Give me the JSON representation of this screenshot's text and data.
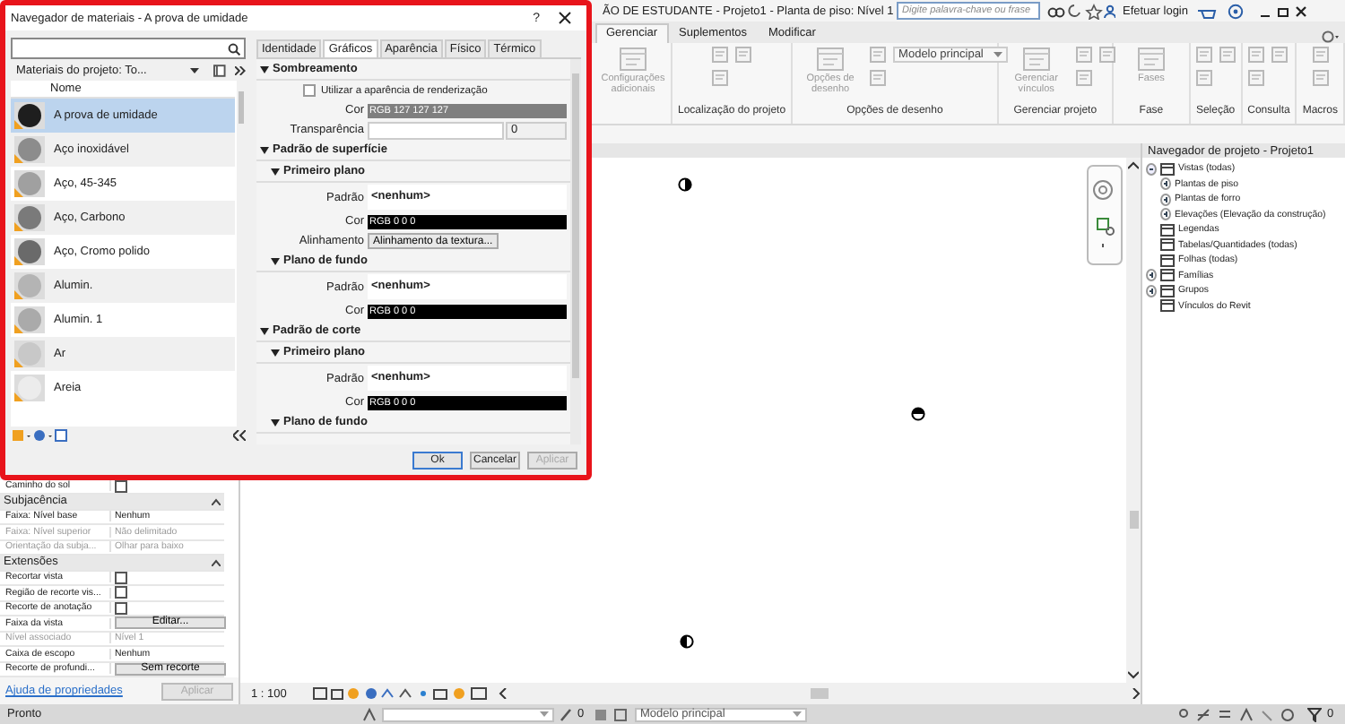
{
  "title_bar": {
    "title": "ÃO DE ESTUDANTE - Projeto1 - Planta de piso: Nível 1",
    "search": {
      "placeholder": "Digite palavra-chave ou frase"
    },
    "login": "Efetuar login"
  },
  "ribbon": {
    "tabs": [
      {
        "label": "Gerenciar",
        "selected": true
      },
      {
        "label": "Suplementos",
        "selected": false
      },
      {
        "label": "Modificar",
        "selected": false
      }
    ],
    "groups": [
      {
        "disabled": true,
        "tools": [
          {
            "kind": "large",
            "label": "Configurações adicionais"
          }
        ]
      },
      {
        "label": "Localização do projeto",
        "disabled": true,
        "tools": [
          {
            "kind": "small"
          },
          {
            "kind": "small"
          },
          {
            "kind": "small"
          }
        ]
      },
      {
        "label": "Opções de desenho",
        "disabled": true,
        "tools": [
          {
            "kind": "large",
            "label": "Opções de desenho"
          },
          {
            "kind": "small"
          },
          {
            "kind": "small"
          },
          {
            "kind": "dropdown",
            "label": "Modelo principal"
          }
        ]
      },
      {
        "label": "Gerenciar projeto",
        "disabled": true,
        "tools": [
          {
            "kind": "large",
            "label": "Gerenciar vínculos"
          },
          {
            "kind": "small"
          },
          {
            "kind": "small"
          },
          {
            "kind": "small"
          }
        ]
      },
      {
        "label": "Fase",
        "disabled": true,
        "tools": [
          {
            "kind": "large",
            "label": "Fases"
          }
        ]
      },
      {
        "label": "Seleção",
        "disabled": true,
        "tools": [
          {
            "kind": "small"
          },
          {
            "kind": "small"
          },
          {
            "kind": "small"
          }
        ]
      },
      {
        "label": "Consulta",
        "disabled": true,
        "tools": [
          {
            "kind": "small"
          },
          {
            "kind": "small"
          },
          {
            "kind": "small"
          }
        ]
      },
      {
        "label": "Macros",
        "disabled": true,
        "tools": [
          {
            "kind": "small"
          },
          {
            "kind": "small"
          }
        ]
      }
    ]
  },
  "properties": {
    "rows": [
      {
        "kind": "checkbox",
        "label": "Caminho do sol",
        "checked": false
      },
      {
        "kind": "section",
        "label": "Subjacência"
      },
      {
        "kind": "value",
        "label": "Faixa: Nível base",
        "value": "Nenhum",
        "disabled": false
      },
      {
        "kind": "value",
        "label": "Faixa: Nível superior",
        "value": "Não delimitado",
        "disabled": true
      },
      {
        "kind": "value",
        "label": "Orientação da subja...",
        "value": "Olhar para baixo",
        "disabled": true
      },
      {
        "kind": "section",
        "label": "Extensões"
      },
      {
        "kind": "checkbox",
        "label": "Recortar vista",
        "checked": false
      },
      {
        "kind": "checkbox",
        "label": "Região de recorte vis...",
        "checked": false
      },
      {
        "kind": "checkbox",
        "label": "Recorte de anotação",
        "checked": false
      },
      {
        "kind": "button",
        "label": "Faixa da vista",
        "value": "Editar..."
      },
      {
        "kind": "value",
        "label": "Nível associado",
        "value": "Nível 1",
        "disabled": true
      },
      {
        "kind": "value",
        "label": "Caixa de escopo",
        "value": "Nenhum",
        "disabled": false
      },
      {
        "kind": "button",
        "label": "Recorte de profundi...",
        "value": "Sem recorte"
      }
    ],
    "help_link": "Ajuda de propriedades",
    "apply": {
      "label": "Aplicar",
      "disabled": true
    }
  },
  "view": {
    "scale": "1 : 100"
  },
  "project_browser": {
    "title": "Navegador de projeto - Projeto1",
    "tree": [
      {
        "label": "Vistas (todas)",
        "expanded": true,
        "children": [
          {
            "label": "Plantas de piso",
            "expanded": false
          },
          {
            "label": "Plantas de forro",
            "expanded": false
          },
          {
            "label": "Elevações (Elevação da construção)",
            "expanded": false
          }
        ]
      },
      {
        "label": "Legendas"
      },
      {
        "label": "Tabelas/Quantidades (todas)"
      },
      {
        "label": "Folhas (todas)"
      },
      {
        "label": "Famílias",
        "expanded": false
      },
      {
        "label": "Grupos",
        "expanded": false
      },
      {
        "label": "Vínculos do Revit"
      }
    ]
  },
  "status_bar": {
    "status": "Pronto",
    "editable_count": "0",
    "model": "Modelo principal",
    "filter_count": "0"
  },
  "material_browser": {
    "title": "Navegador de materiais - A prova de umidade",
    "help": "?",
    "library_filter": "Materiais do projeto: To...",
    "column": "Nome",
    "materials": [
      {
        "name": "A prova de umidade",
        "selected": true,
        "color": "#1e1e1e"
      },
      {
        "name": "Aço inoxidável",
        "selected": false,
        "color": "#8c8c8c"
      },
      {
        "name": "Aço, 45-345",
        "selected": false,
        "color": "#a0a0a0"
      },
      {
        "name": "Aço, Carbono",
        "selected": false,
        "color": "#7a7a7a"
      },
      {
        "name": "Aço, Cromo polido",
        "selected": false,
        "color": "#6a6a6a"
      },
      {
        "name": "Alumin.",
        "selected": false,
        "color": "#b4b4b4"
      },
      {
        "name": "Alumin. 1",
        "selected": false,
        "color": "#aaaaaa"
      },
      {
        "name": "Ar",
        "selected": false,
        "color": "#c8c8c8"
      },
      {
        "name": "Areia",
        "selected": false,
        "color": "#ececec"
      }
    ],
    "tabs": [
      {
        "label": "Identidade",
        "selected": false
      },
      {
        "label": "Gráficos",
        "selected": true
      },
      {
        "label": "Aparência",
        "selected": false
      },
      {
        "label": "Físico",
        "selected": false
      },
      {
        "label": "Térmico",
        "selected": false
      }
    ],
    "sections": [
      {
        "label": "Sombreamento",
        "rows": [
          {
            "kind": "checkbox",
            "label": "Utilizar a aparência de renderização",
            "checked": false
          },
          {
            "kind": "color",
            "label": "Cor",
            "value": "RGB 127 127 127",
            "color": "#7f7f7f"
          },
          {
            "kind": "transparency",
            "label": "Transparência",
            "value": "0"
          }
        ]
      },
      {
        "label": "Padrão de superfície",
        "subsections": [
          {
            "label": "Primeiro plano",
            "rows": [
              {
                "kind": "pattern",
                "label": "Padrão",
                "value": "<nenhum>"
              },
              {
                "kind": "color",
                "label": "Cor",
                "value": "RGB 0 0 0",
                "color": "#000000"
              },
              {
                "kind": "button",
                "label": "Alinhamento",
                "value": "Alinhamento da textura..."
              }
            ]
          },
          {
            "label": "Plano de fundo",
            "rows": [
              {
                "kind": "pattern",
                "label": "Padrão",
                "value": "<nenhum>"
              },
              {
                "kind": "color",
                "label": "Cor",
                "value": "RGB 0 0 0",
                "color": "#000000"
              }
            ]
          }
        ]
      },
      {
        "label": "Padrão de corte",
        "subsections": [
          {
            "label": "Primeiro plano",
            "rows": [
              {
                "kind": "pattern",
                "label": "Padrão",
                "value": "<nenhum>"
              },
              {
                "kind": "color",
                "label": "Cor",
                "value": "RGB 0 0 0",
                "color": "#000000"
              }
            ]
          },
          {
            "label": "Plano de fundo"
          }
        ]
      }
    ],
    "buttons": [
      {
        "label": "Ok",
        "default": true,
        "disabled": false
      },
      {
        "label": "Cancelar",
        "default": false,
        "disabled": false
      },
      {
        "label": "Aplicar",
        "default": false,
        "disabled": true
      }
    ]
  }
}
